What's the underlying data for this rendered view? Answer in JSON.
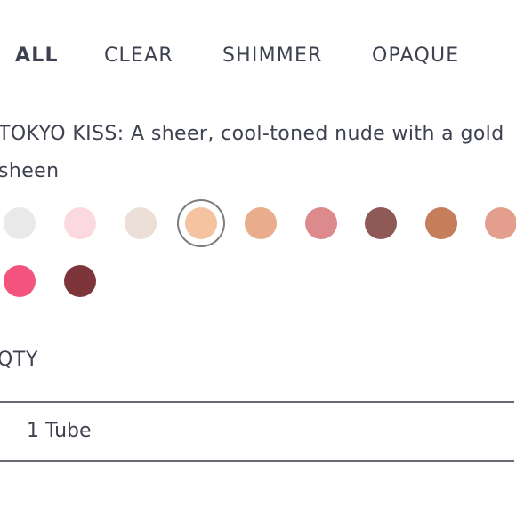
{
  "tabs": [
    {
      "label": "ALL",
      "active": true
    },
    {
      "label": "CLEAR",
      "active": false
    },
    {
      "label": "SHIMMER",
      "active": false
    },
    {
      "label": "OPAQUE",
      "active": false
    }
  ],
  "shade_description": "TOKYO KISS: A sheer, cool-toned nude with a gold sheen",
  "swatches": [
    {
      "color": "#e9e9e9",
      "selected": false
    },
    {
      "color": "#fcd9e1",
      "selected": false
    },
    {
      "color": "#ecdfd8",
      "selected": false
    },
    {
      "color": "#f6c3a1",
      "selected": true
    },
    {
      "color": "#e9ac8d",
      "selected": false
    },
    {
      "color": "#dd8a8d",
      "selected": false
    },
    {
      "color": "#8f5a55",
      "selected": false
    },
    {
      "color": "#c57d5c",
      "selected": false
    },
    {
      "color": "#e49e8e",
      "selected": false
    },
    {
      "color": "#f3537c",
      "selected": false
    },
    {
      "color": "#7d343b",
      "selected": false
    }
  ],
  "quantity": {
    "label": "QTY",
    "value": "1 Tube"
  }
}
